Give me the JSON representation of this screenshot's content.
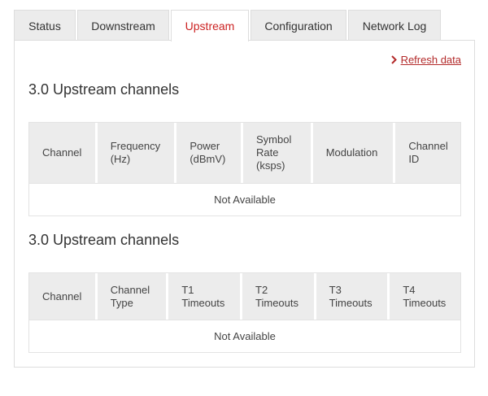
{
  "tabs": [
    {
      "label": "Status"
    },
    {
      "label": "Downstream"
    },
    {
      "label": "Upstream"
    },
    {
      "label": "Configuration"
    },
    {
      "label": "Network Log"
    }
  ],
  "active_tab": "Upstream",
  "refresh": {
    "label": "Refresh data",
    "icon": "chevron-right-icon",
    "color": "#b32a2a"
  },
  "section1": {
    "title": "3.0 Upstream channels",
    "columns": [
      "Channel",
      "Frequency\n(Hz)",
      "Power\n(dBmV)",
      "Symbol\nRate\n(ksps)",
      "Modulation",
      "Channel\nID"
    ],
    "empty_text": "Not Available"
  },
  "section2": {
    "title": "3.0 Upstream channels",
    "columns": [
      "Channel",
      "Channel\nType",
      "T1\nTimeouts",
      "T2\nTimeouts",
      "T3\nTimeouts",
      "T4\nTimeouts"
    ],
    "empty_text": "Not Available"
  },
  "colors": {
    "accent": "#cc2222",
    "header_bg": "#ececec"
  }
}
